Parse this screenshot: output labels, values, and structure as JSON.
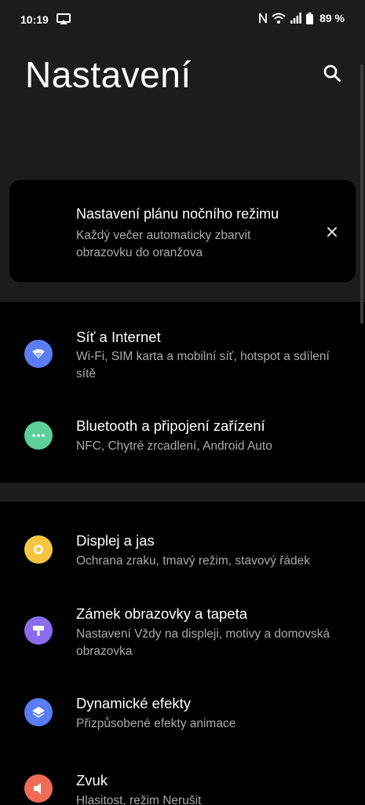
{
  "status_bar": {
    "time": "10:19",
    "battery": "89 %"
  },
  "header": {
    "title": "Nastavení"
  },
  "night_card": {
    "title": "Nastavení plánu nočního režimu",
    "subtitle": "Každý večer automaticky zbarvit obrazovku do oranžova"
  },
  "items": [
    {
      "title": "Síť a Internet",
      "subtitle": "Wi-Fi, SIM karta a mobilní síť, hotspot a sdílení sítě",
      "color": "#5b7cf2"
    },
    {
      "title": "Bluetooth a připojení zařízení",
      "subtitle": "NFC, Chytré zrcadlení, Android Auto",
      "color": "#5fcf9a"
    },
    {
      "title": "Displej a jas",
      "subtitle": "Ochrana zraku, tmavý režim, stavový řádek",
      "color": "#f5c542"
    },
    {
      "title": "Zámek obrazovky a tapeta",
      "subtitle": "Nastavení Vždy na displeji, motivy a domovská obrazovka",
      "color": "#8a6cf0"
    },
    {
      "title": "Dynamické efekty",
      "subtitle": "Přizpůsobené efekty animace",
      "color": "#5b7cf2"
    },
    {
      "title": "Zvuk",
      "subtitle": "Hlasitost, režim Nerušit",
      "color": "#f06b55"
    }
  ]
}
